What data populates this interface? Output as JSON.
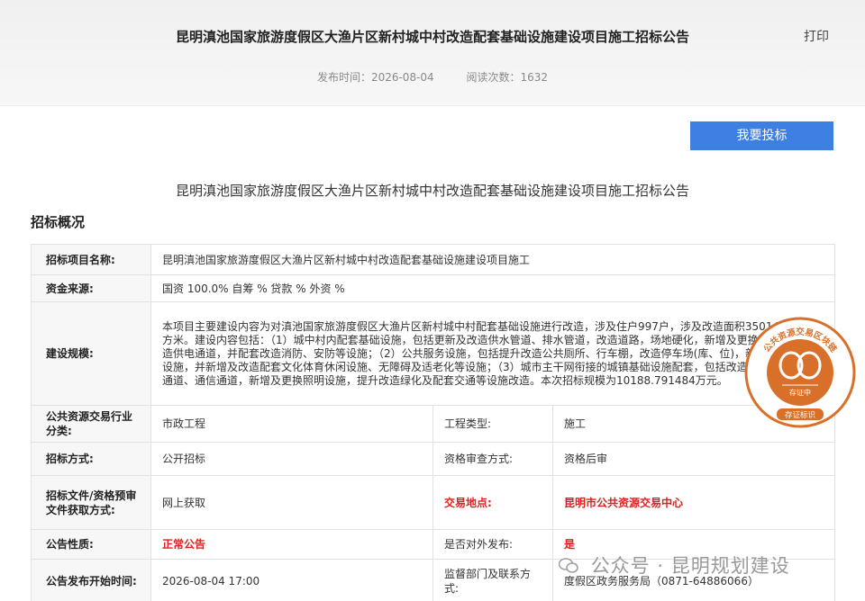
{
  "header": {
    "title": "昆明滇池国家旅游度假区大渔片区新村城中村改造配套基础设施建设项目施工招标公告",
    "print_label": "打印",
    "publish_time": "发布时间：2026-08-04",
    "read_count": "阅读次数：1632"
  },
  "bid_button": "我要投标",
  "sub_title": "昆明滇池国家旅游度假区大渔片区新村城中村改造配套基础设施建设项目施工招标公告",
  "section_title": "招标概况",
  "table": {
    "project_name_label": "招标项目名称:",
    "project_name": "昆明滇池国家旅游度假区大渔片区新村城中村改造配套基础设施建设项目施工",
    "fund_label": "资金来源:",
    "fund": "国资 100.0% 自筹 % 贷款 % 外资 %",
    "scale_label": "建设规模:",
    "scale": "本项目主要建设内容为对滇池国家旅游度假区大渔片区新村城中村配套基础设施进行改造，涉及住户997户，涉及改造面积35014 0.63平方米。建设内容包括：（1）城中村内配套基础设施，包括更新及改造供水管道、排水管道，改造道路，场地硬化，新增及更换照明设施，改造供电通道，并配套改造消防、安防等设施；（2）公共服务设施，包括提升改造公共厕所、行车棚，改造停车场(库、位)，新增及改造环卫设施，并新增及改造配套文化体育休闲设施、无障碍及适老化等设施；（3）城市主干网衔接的城镇基础设施配套，包括改造道路，改造供电通道、通信通道，新增及更换照明设施，提升改造绿化及配套交通等设施改造。本次招标规模为10188.791484万元。",
    "category_label": "公共资源交易行业分类:",
    "category": "市政工程",
    "project_type_label": "工程类型:",
    "project_type": "施工",
    "method_label": "招标方式:",
    "method": "公开招标",
    "qualification_label": "资格审查方式:",
    "qualification": "资格后审",
    "doc_label": "招标文件/资格预审文件获取方式:",
    "doc": "网上获取",
    "venue_label": "交易地点:",
    "venue": "昆明市公共资源交易中心",
    "nature_label": "公告性质:",
    "nature": "正常公告",
    "external_label": "是否对外发布:",
    "external": "是",
    "start_label": "公告发布开始时间:",
    "start": "2026-08-04 17:00",
    "supervisor_label": "监督部门及联系方式:",
    "supervisor": "度假区政务服务局（0871-64886066）"
  },
  "stamp": {
    "top_text": "公共资源交易区块链",
    "middle_text": "存证中",
    "bottom_text": "存证标识",
    "color": "#d9702a"
  },
  "watermark": {
    "text": "公众号 · 昆明规划建设",
    "icon": "wechat-icon"
  }
}
